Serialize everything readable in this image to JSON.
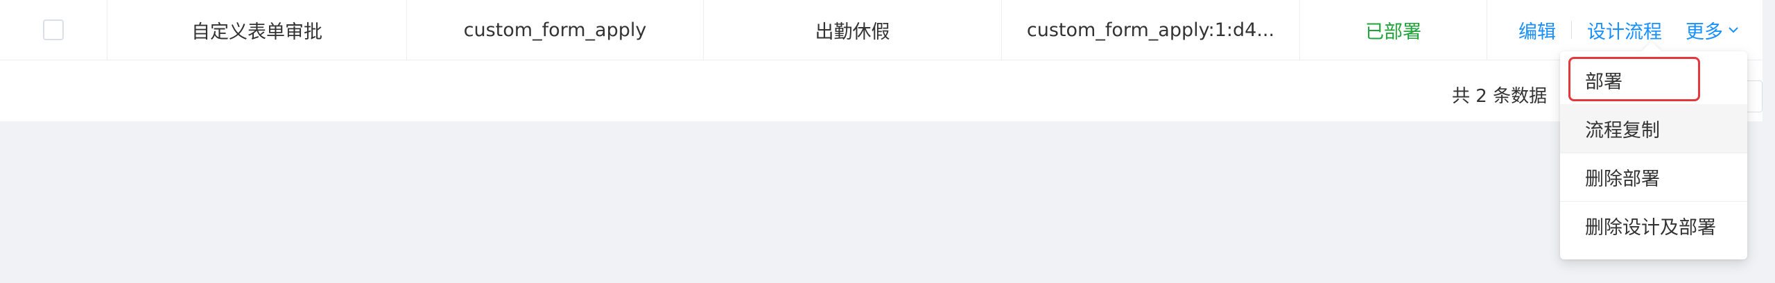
{
  "row": {
    "name": "自定义表单审批",
    "key": "custom_form_apply",
    "category": "出勤休假",
    "definition_id": "custom_form_apply:1:d4...",
    "status": "已部署"
  },
  "ops": {
    "edit": "编辑",
    "design": "设计流程",
    "more": "更多"
  },
  "footer": {
    "total": "共 2 条数据"
  },
  "more_menu": {
    "items": [
      "部署",
      "流程复制",
      "删除部署",
      "删除设计及部署"
    ]
  },
  "colors": {
    "link": "#1890ff",
    "status_deployed": "#20a53a",
    "highlight": "#e4393c"
  },
  "icons": {
    "more_chevron": "chevron-down-icon"
  }
}
